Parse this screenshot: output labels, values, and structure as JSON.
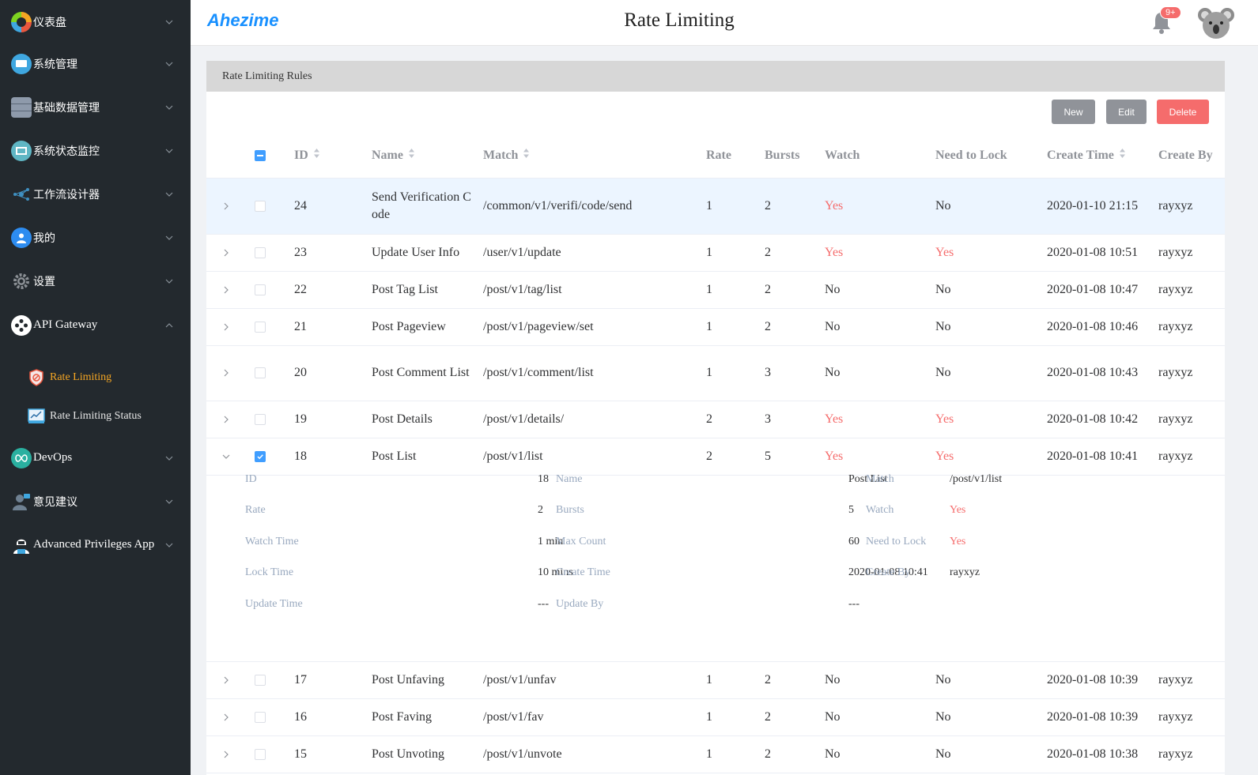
{
  "sidebar": {
    "items": [
      {
        "label": "仪表盘",
        "icon": "dashboard-icon",
        "color": "#e9573f"
      },
      {
        "label": "系统管理",
        "icon": "monitor-icon",
        "color": "#3fa7e0"
      },
      {
        "label": "基础数据管理",
        "icon": "database-icon",
        "color": "#6b7a8f"
      },
      {
        "label": "系统状态监控",
        "icon": "status-monitor-icon",
        "color": "#5fb6c4"
      },
      {
        "label": "工作流设计器",
        "icon": "workflow-icon",
        "color": "#3f8fc0"
      },
      {
        "label": "我的",
        "icon": "user-icon",
        "color": "#2d8cf0"
      },
      {
        "label": "设置",
        "icon": "gear-icon",
        "color": "#8a8f94"
      },
      {
        "label": "API Gateway",
        "icon": "api-gateway-icon",
        "color": "#ffffff"
      },
      {
        "label": "DevOps",
        "icon": "infinity-icon",
        "color": "#2ab0a0"
      },
      {
        "label": "意见建议",
        "icon": "feedback-icon",
        "color": "#5e6f7f"
      },
      {
        "label": "Advanced Privileges App",
        "icon": "hacker-icon",
        "color": "#ffffff"
      }
    ],
    "sub_items": [
      {
        "label": "Rate Limiting",
        "icon": "shield-icon",
        "active": true
      },
      {
        "label": "Rate Limiting Status",
        "icon": "chart-board-icon",
        "active": false
      }
    ]
  },
  "header": {
    "logo": "Ahezime",
    "title": "Rate Limiting",
    "badge": "9+"
  },
  "card": {
    "title": "Rate Limiting Rules",
    "buttons": {
      "new": "New",
      "edit": "Edit",
      "delete": "Delete"
    }
  },
  "table": {
    "columns": {
      "id": "ID",
      "name": "Name",
      "match": "Match",
      "rate": "Rate",
      "bursts": "Bursts",
      "watch": "Watch",
      "need_to_lock": "Need to Lock",
      "create_time": "Create Time",
      "create_by": "Create By"
    },
    "rows": [
      {
        "id": "24",
        "name": "Send Verification Code",
        "match": "/common/v1/verifi/code/send",
        "rate": "1",
        "bursts": "2",
        "watch": "Yes",
        "lock": "No",
        "time": "2020-01-10 21:15",
        "by": "rayxyz"
      },
      {
        "id": "23",
        "name": "Update User Info",
        "match": "/user/v1/update",
        "rate": "1",
        "bursts": "2",
        "watch": "Yes",
        "lock": "Yes",
        "time": "2020-01-08 10:51",
        "by": "rayxyz"
      },
      {
        "id": "22",
        "name": "Post Tag List",
        "match": "/post/v1/tag/list",
        "rate": "1",
        "bursts": "2",
        "watch": "No",
        "lock": "No",
        "time": "2020-01-08 10:47",
        "by": "rayxyz"
      },
      {
        "id": "21",
        "name": "Post Pageview",
        "match": "/post/v1/pageview/set",
        "rate": "1",
        "bursts": "2",
        "watch": "No",
        "lock": "No",
        "time": "2020-01-08 10:46",
        "by": "rayxyz"
      },
      {
        "id": "20",
        "name": "Post Comment List",
        "match": "/post/v1/comment/list",
        "rate": "1",
        "bursts": "3",
        "watch": "No",
        "lock": "No",
        "time": "2020-01-08 10:43",
        "by": "rayxyz"
      },
      {
        "id": "19",
        "name": "Post Details",
        "match": "/post/v1/details/",
        "rate": "2",
        "bursts": "3",
        "watch": "Yes",
        "lock": "Yes",
        "time": "2020-01-08 10:42",
        "by": "rayxyz"
      },
      {
        "id": "18",
        "name": "Post List",
        "match": "/post/v1/list",
        "rate": "2",
        "bursts": "5",
        "watch": "Yes",
        "lock": "Yes",
        "time": "2020-01-08 10:41",
        "by": "rayxyz"
      },
      {
        "id": "17",
        "name": "Post Unfaving",
        "match": "/post/v1/unfav",
        "rate": "1",
        "bursts": "2",
        "watch": "No",
        "lock": "No",
        "time": "2020-01-08 10:39",
        "by": "rayxyz"
      },
      {
        "id": "16",
        "name": "Post Faving",
        "match": "/post/v1/fav",
        "rate": "1",
        "bursts": "2",
        "watch": "No",
        "lock": "No",
        "time": "2020-01-08 10:39",
        "by": "rayxyz"
      },
      {
        "id": "15",
        "name": "Post Unvoting",
        "match": "/post/v1/unvote",
        "rate": "1",
        "bursts": "2",
        "watch": "No",
        "lock": "No",
        "time": "2020-01-08 10:38",
        "by": "rayxyz"
      }
    ],
    "detail": {
      "labels": {
        "id": "ID",
        "name": "Name",
        "match": "Match",
        "rate": "Rate",
        "bursts": "Bursts",
        "watch": "Watch",
        "watch_time": "Watch Time",
        "max_count": "Max Count",
        "need_to_lock": "Need to Lock",
        "lock_time": "Lock Time",
        "create_time": "Create Time",
        "create_by": "Create By",
        "update_time": "Update Time",
        "update_by": "Update By"
      },
      "values": {
        "id": "18",
        "name": "Post List",
        "match": "/post/v1/list",
        "rate": "2",
        "bursts": "5",
        "watch": "Yes",
        "watch_time": "1 min",
        "max_count": "60",
        "need_to_lock": "Yes",
        "lock_time": "10 mins",
        "create_time": "2020-01-08 10:41",
        "create_by": "rayxyz",
        "update_time": "---",
        "update_by": "---"
      }
    }
  }
}
